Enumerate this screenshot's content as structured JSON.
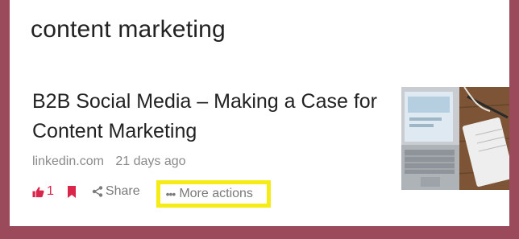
{
  "search": {
    "query": "content marketing"
  },
  "article": {
    "title": "B2B Social Media – Making a Case for Content Marketing",
    "source": "linkedin.com",
    "age": "21 days ago",
    "likes": "1",
    "share_label": "Share",
    "more_label": "More actions",
    "thumbnail": "laptop-on-desk-photo"
  },
  "colors": {
    "page_background": "#9b4a5c",
    "accent": "#d9264a",
    "highlight_box": "#f4ec14"
  }
}
